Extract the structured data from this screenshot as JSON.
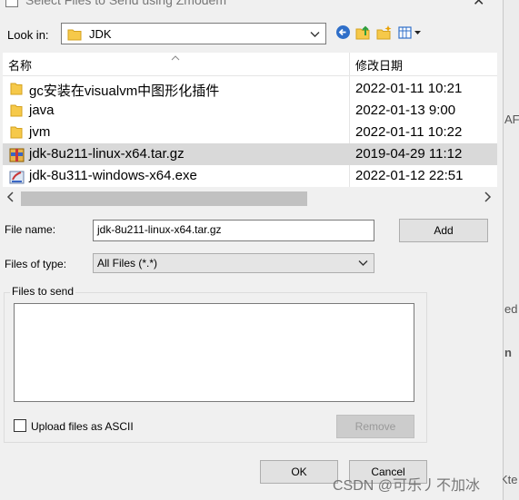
{
  "window": {
    "title": "Select Files to Send using Zmodem",
    "close_glyph": "✕"
  },
  "look_in": {
    "label": "Look in:",
    "value": "JDK"
  },
  "toolbar": {
    "back_icon": "back-arrow-icon",
    "up_icon": "up-folder-icon",
    "new_folder_icon": "new-folder-icon",
    "view_menu_icon": "view-menu-icon"
  },
  "file_list": {
    "columns": [
      "名称",
      "修改日期"
    ],
    "rows": [
      {
        "name": "gc安装在visualvm中图形化插件",
        "date": "2022-01-11 10:21",
        "icon": "folder-icon",
        "selected": false
      },
      {
        "name": "java",
        "date": "2022-01-13 9:00",
        "icon": "folder-icon",
        "selected": false
      },
      {
        "name": "jvm",
        "date": "2022-01-11 10:22",
        "icon": "folder-icon",
        "selected": false
      },
      {
        "name": "jdk-8u211-linux-x64.tar.gz",
        "date": "2019-04-29 11:12",
        "icon": "archive-icon",
        "selected": true
      },
      {
        "name": "jdk-8u311-windows-x64.exe",
        "date": "2022-01-12 22:51",
        "icon": "installer-icon",
        "selected": false
      }
    ]
  },
  "file_name": {
    "label": "File name:",
    "value": "jdk-8u211-linux-x64.tar.gz"
  },
  "files_of_type": {
    "label": "Files of type:",
    "value": "All Files (*.*)"
  },
  "files_to_send": {
    "label": "Files to send"
  },
  "upload_ascii": {
    "label": "Upload files as ASCII",
    "checked": false
  },
  "buttons": {
    "add": "Add",
    "remove": "Remove",
    "ok": "OK",
    "cancel": "Cancel"
  },
  "background": {
    "snippets": [
      "AF",
      "ed",
      "n",
      "Kte"
    ]
  },
  "watermark": "CSDN @可乐丿不加冰"
}
